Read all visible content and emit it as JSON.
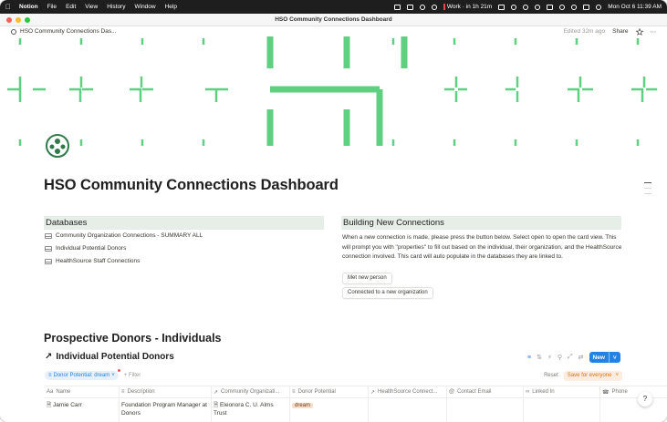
{
  "menubar": {
    "app": "Notion",
    "items": [
      "File",
      "Edit",
      "View",
      "History",
      "Window",
      "Help"
    ],
    "status": "Work · in 1h 21m",
    "datetime": "Mon Oct 6  11:39 AM"
  },
  "window": {
    "title": "HSO Community Connections Dashboard"
  },
  "topbar": {
    "breadcrumb": "HSO Community Connections Das...",
    "edited": "Edited 32m ago",
    "share": "Share"
  },
  "page": {
    "title": "HSO Community Connections Dashboard"
  },
  "databases": {
    "heading": "Databases",
    "links": [
      "Community Organization Connections - SUMMARY ALL",
      "Individual Potential Donors",
      "HealthSource Staff Connections"
    ]
  },
  "building": {
    "heading": "Building New Connections",
    "text": "When a new connection is made, please press the button below. Select open to open the card view. This will prompt you with \"properties\" to fill out based on the individual, their organization, and the HealthSource connection involved. This card will auto populate in the databases they are linked to.",
    "btn1": "Met new person",
    "btn2": "Connected to a new organization"
  },
  "prospective": {
    "heading": "Prospective Donors - Individuals",
    "db_title": "Individual Potential Donors",
    "new_label": "New",
    "filter_chip": "Donor Potential: dream",
    "add_filter": "Filter",
    "reset": "Reset",
    "save": "Save for everyone",
    "columns": [
      "Name",
      "Description",
      "Community Organizati...",
      "Donor Potential",
      "HealthSource Connect...",
      "Contact Email",
      "Linked In",
      "Phone"
    ],
    "rows": [
      {
        "name": "Jamie Carr",
        "description": "Foundation Program Manager at",
        "description2": "Donors",
        "org": "Eleonora C. U. Alms",
        "org2": "Trust",
        "potential": "dream"
      }
    ]
  },
  "colors": {
    "accent": "#2383e2",
    "cover_green": "#5fcf80",
    "heading_bg": "#e7ede7"
  }
}
